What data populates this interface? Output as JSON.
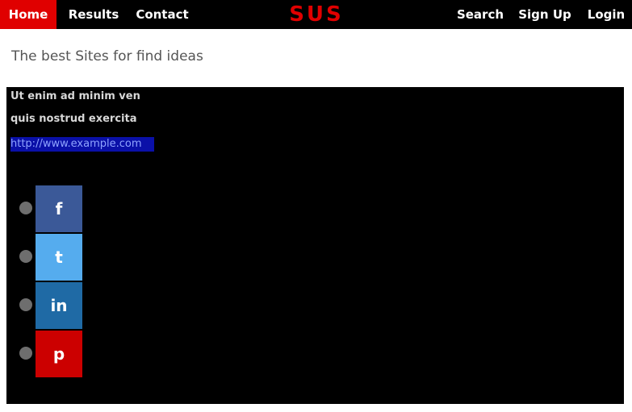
{
  "nav": {
    "home": "Home",
    "results": "Results",
    "contact": "Contact",
    "search": "Search",
    "signup": "Sign Up",
    "login": "Login"
  },
  "brand": "SUS",
  "tagline": "The best Sites for find ideas",
  "panel": {
    "line1": "Ut enim ad minim ven",
    "line2": "quis nostrud exercita",
    "link": "http://www.example.com"
  },
  "share": [
    {
      "network": "facebook",
      "icon": "f",
      "color": "#3b5998"
    },
    {
      "network": "twitter",
      "icon": "t",
      "color": "#55acee"
    },
    {
      "network": "linkedin",
      "icon": "in",
      "color": "#1f6aa5"
    },
    {
      "network": "pinterest",
      "icon": "p",
      "color": "#cc0000"
    }
  ],
  "colors": {
    "accent": "#e00000",
    "nav_bg": "#000000",
    "link_bg": "#0a10a8"
  }
}
